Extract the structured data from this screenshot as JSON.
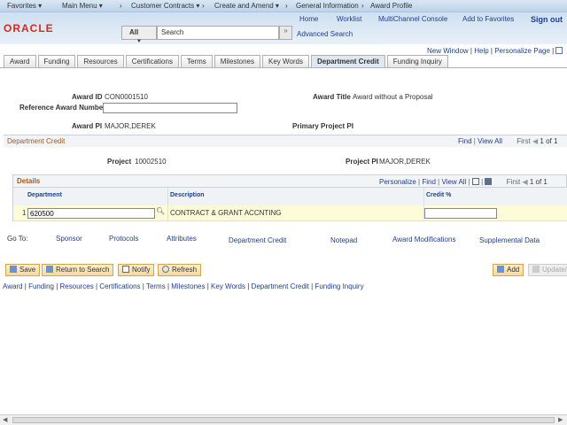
{
  "nav": {
    "items": [
      "Favorites ▾",
      "Main Menu ▾",
      "›",
      "Customer Contracts ▾",
      "›",
      "Create and Amend ▾",
      "›",
      "General Information",
      "›",
      "Award Profile"
    ]
  },
  "header": {
    "logo": "ORACLE",
    "links": [
      "Home",
      "Worklist",
      "MultiChannel Console",
      "Add to Favorites",
      "Sign out"
    ],
    "search_scope": "All",
    "search_placeholder": "Search",
    "advanced_search": "Advanced Search"
  },
  "toplinks": [
    "New Window",
    "Help",
    "Personalize Page"
  ],
  "tabs": [
    "Award",
    "Funding",
    "Resources",
    "Certifications",
    "Terms",
    "Milestones",
    "Key Words",
    "Department Credit",
    "Funding Inquiry"
  ],
  "active_tab": "Department Credit",
  "award": {
    "award_id_label": "Award ID",
    "award_id": "CON0001510",
    "award_title_label": "Award Title",
    "award_title": "Award without a Proposal",
    "ref_label": "Reference Award Number",
    "ref_value": "",
    "pi_label": "Award PI",
    "pi": "MAJOR,DEREK",
    "primary_pi_label": "Primary Project PI"
  },
  "dept_credit": {
    "title": "Department Credit",
    "find": "Find",
    "view_all": "View All",
    "first": "First",
    "count": "1 of 1",
    "project_label": "Project",
    "project": "10002510",
    "project_pi_label": "Project PI",
    "project_pi": "MAJOR,DEREK"
  },
  "details": {
    "title": "Details",
    "personalize": "Personalize",
    "find": "Find",
    "view_all": "View All",
    "first": "First",
    "count": "1 of 1",
    "columns": [
      "Department",
      "Description",
      "Credit %"
    ],
    "rows": [
      {
        "num": "1",
        "department": "620500",
        "description": "CONTRACT & GRANT ACCNTING",
        "credit": ""
      }
    ]
  },
  "goto": {
    "label": "Go To:",
    "links": [
      "Sponsor",
      "Protocols",
      "Attributes",
      "Department Credit",
      "Notepad",
      "Award Modifications",
      "Supplemental Data"
    ]
  },
  "buttons": {
    "save": "Save",
    "return": "Return to Search",
    "notify": "Notify",
    "refresh": "Refresh",
    "add": "Add",
    "update": "Update/Display"
  },
  "footer_links": [
    "Award",
    "Funding",
    "Resources",
    "Certifications",
    "Terms",
    "Milestones",
    "Key Words",
    "Department Credit",
    "Funding Inquiry"
  ]
}
